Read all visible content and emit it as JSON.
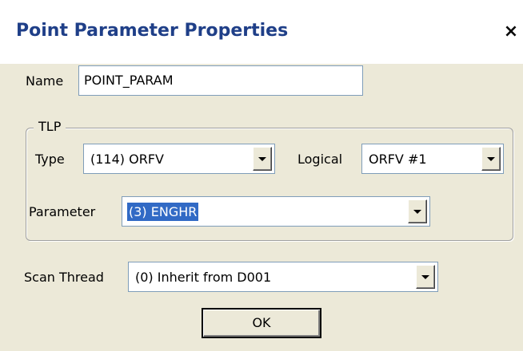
{
  "window": {
    "title": "Point Parameter Properties",
    "close_glyph": "×"
  },
  "name_field": {
    "label": "Name",
    "value": "POINT_PARAM"
  },
  "tlp_group": {
    "legend": "TLP",
    "type": {
      "label": "Type",
      "value": "(114) ORFV"
    },
    "logical": {
      "label": "Logical",
      "value": "ORFV #1"
    },
    "parameter": {
      "label": "Parameter",
      "value": "(3) ENGHR"
    }
  },
  "scan_thread": {
    "label": "Scan Thread",
    "value": "(0) Inherit from D001"
  },
  "buttons": {
    "ok_label": "OK"
  },
  "colors": {
    "dialog_bg": "#ece9d8",
    "title_text": "#1f3f88",
    "selection": "#316ac5"
  }
}
